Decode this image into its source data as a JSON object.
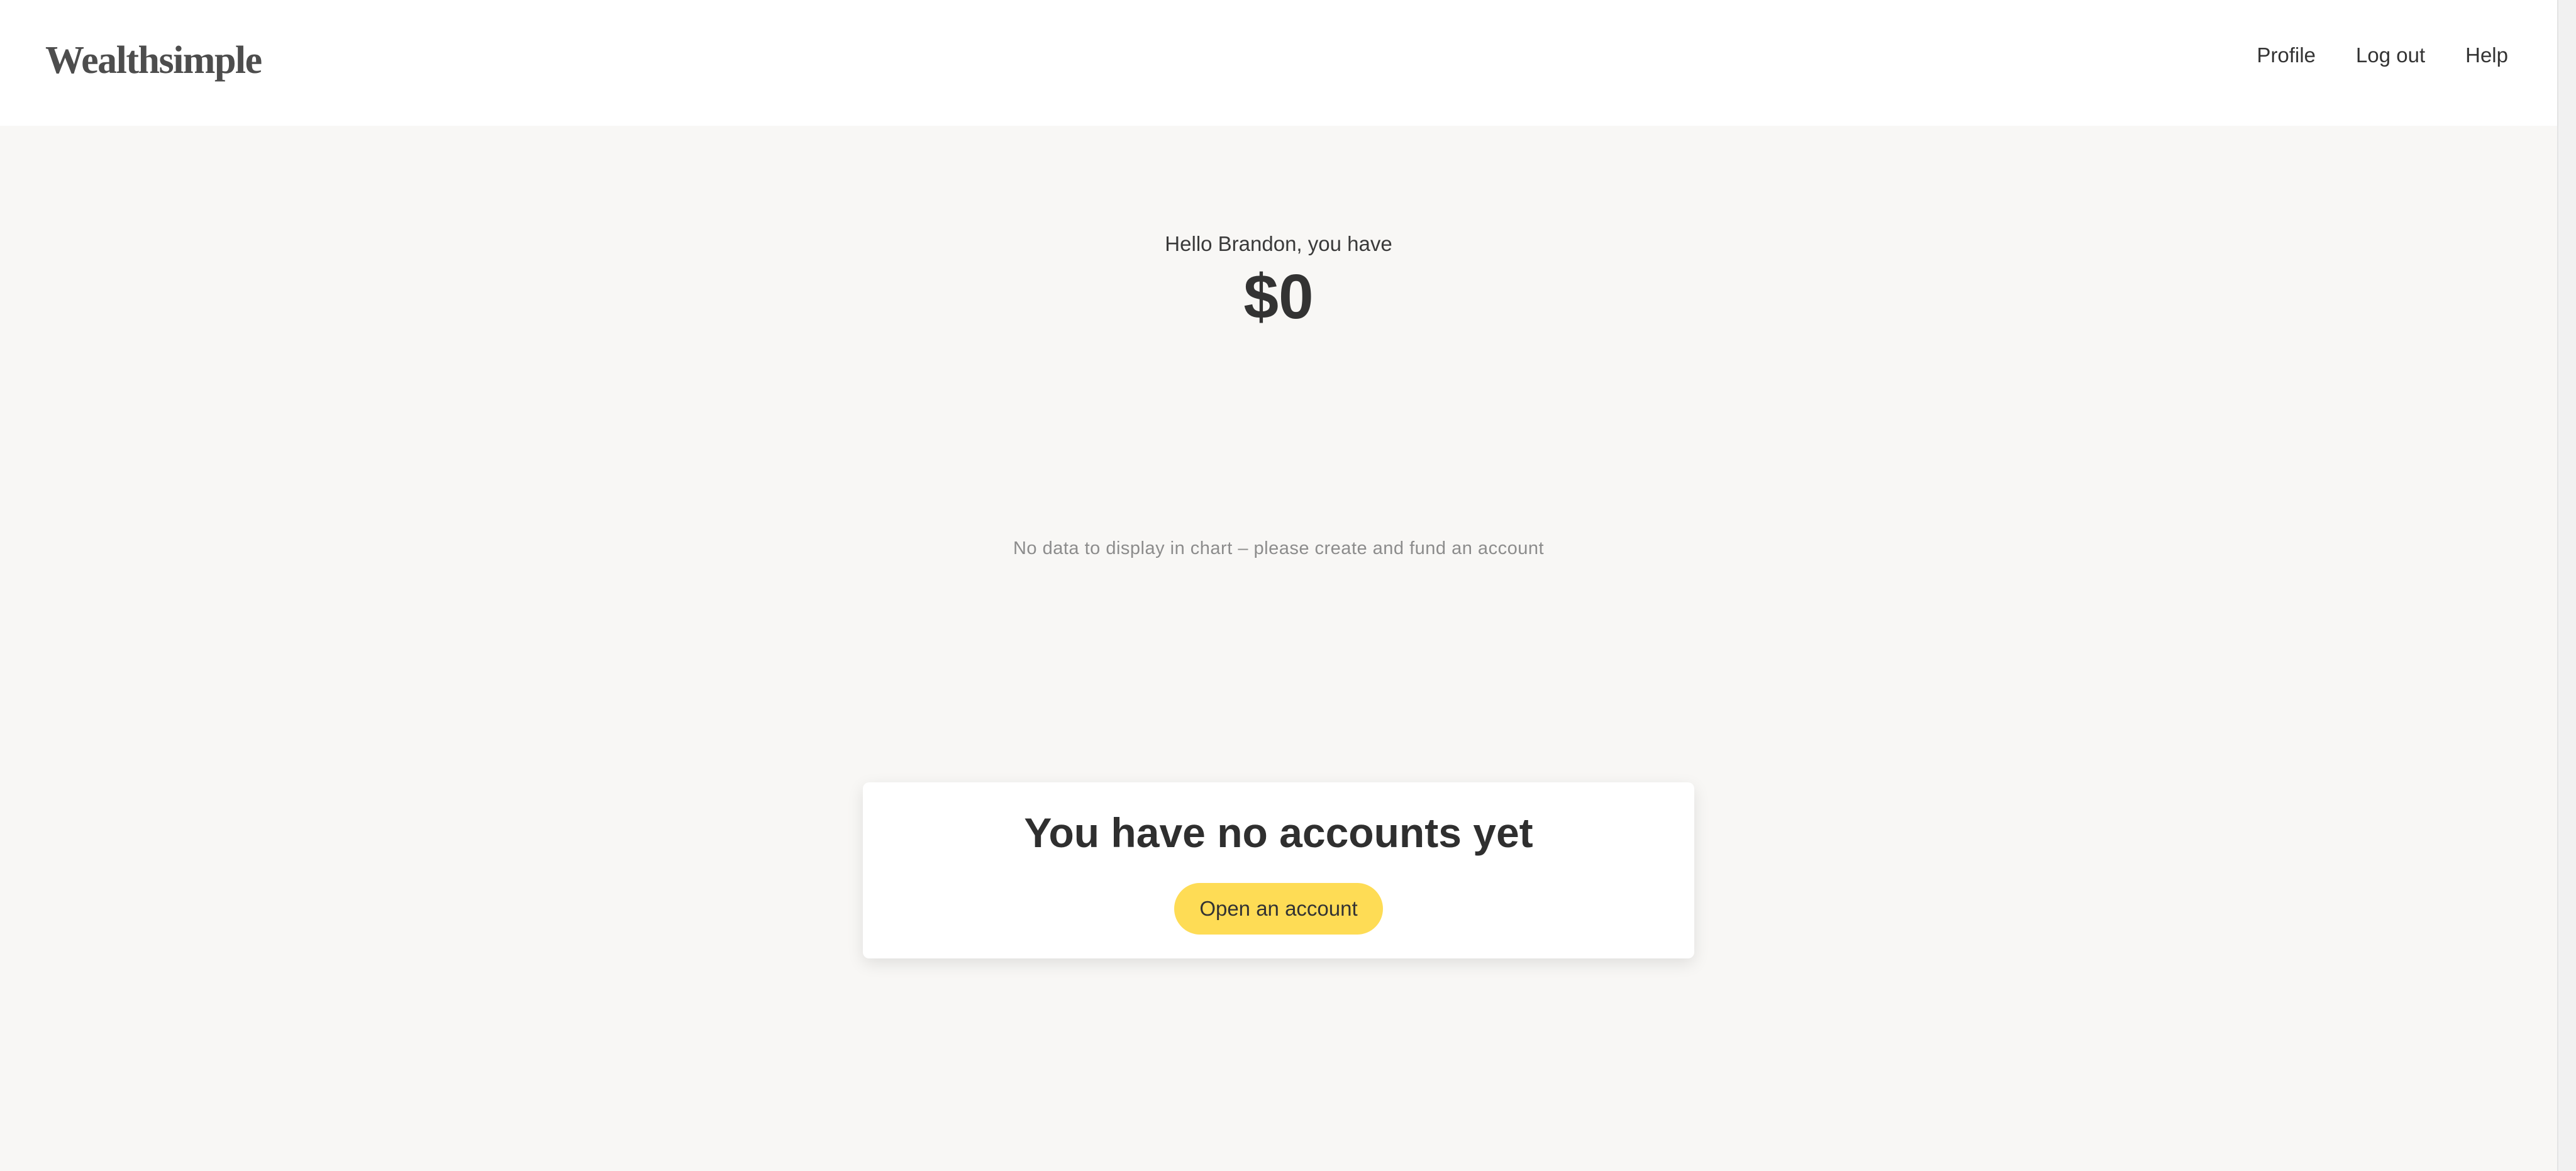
{
  "header": {
    "logo_text": "Wealthsimple",
    "nav": [
      {
        "label": "Profile"
      },
      {
        "label": "Log out"
      },
      {
        "label": "Help"
      }
    ]
  },
  "summary": {
    "greeting": "Hello Brandon, you have",
    "balance": "$0"
  },
  "chart": {
    "empty_message": "No data to display in chart – please create and fund an account"
  },
  "accounts_card": {
    "title": "You have no accounts yet",
    "button_label": "Open an account"
  },
  "colors": {
    "background": "#f8f7f5",
    "header_background": "#ffffff",
    "accent_button": "#fedc55",
    "text_primary": "#333333",
    "text_muted": "#8c8c8c"
  }
}
